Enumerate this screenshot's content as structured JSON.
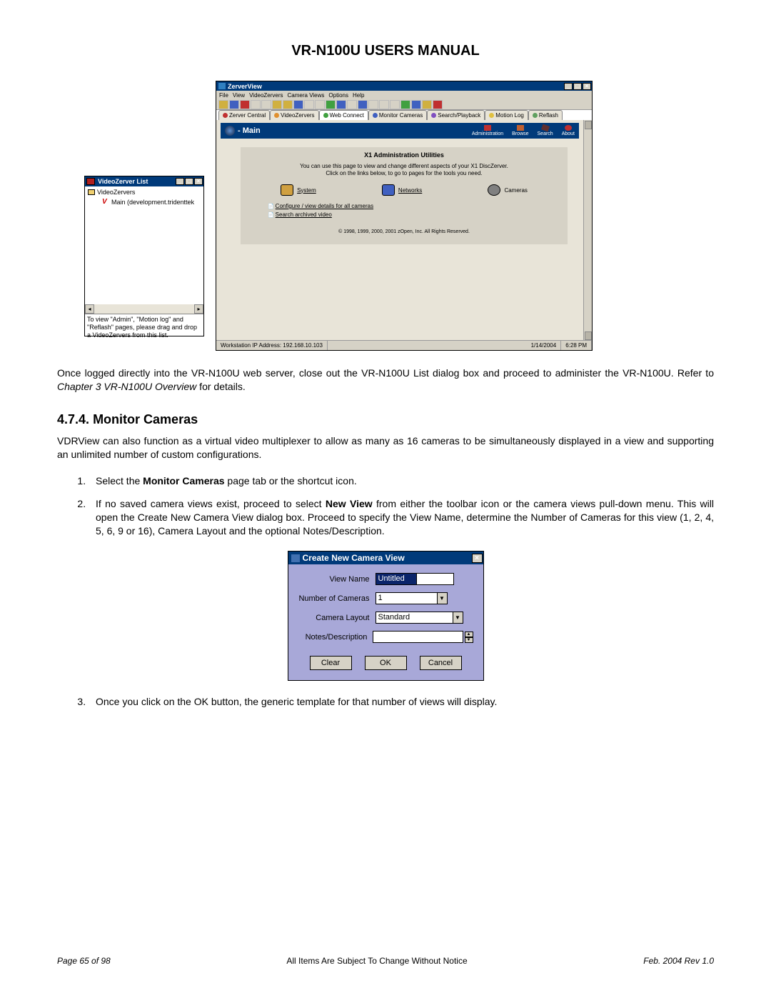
{
  "doc": {
    "title": "VR-N100U USERS MANUAL",
    "para1": "Once logged directly into the VR-N100U web server, close out the VR-N100U List dialog box and proceed to administer the VR-N100U. Refer to ",
    "para1_italic": "Chapter 3 VR-N100U Overview",
    "para1_tail": " for details.",
    "section_num": "4.7.4.",
    "section_title": "Monitor Cameras",
    "para2": "VDRView can also function as a virtual video multiplexer to allow as many as 16 cameras to be simultaneously displayed in a view and supporting an unlimited number of custom configurations.",
    "step1_pre": "Select the ",
    "step1_b": "Monitor Cameras",
    "step1_post": " page tab or the shortcut icon.",
    "step2_pre": "If no saved camera views exist, proceed to select ",
    "step2_b": "New View",
    "step2_post": " from either the toolbar icon or the camera views pull-down menu. This will open the Create New Camera View dialog box. Proceed to specify the View Name, determine the Number of Cameras for this view (1, 2, 4, 5, 6, 9 or 16), Camera Layout and the optional Notes/Description.",
    "step3": "Once you click on the OK button, the generic template for that number of views will display."
  },
  "vzlist": {
    "title": "VideoZerver List",
    "root": "VideoZervers",
    "child": "Main (development.tridenttek",
    "hint": "To view \"Admin\", \"Motion log\" and \"Reflash\" pages, please drag and drop a VideoZervers from this list."
  },
  "zv": {
    "title": "ZerverView",
    "menu": [
      "File",
      "View",
      "VideoZervers",
      "Camera Views",
      "Options",
      "Help"
    ],
    "tabs": [
      "Zerver Central",
      "VideoZervers",
      "Web Connect",
      "Monitor Cameras",
      "Search/Playback",
      "Motion Log",
      "Reflash"
    ],
    "banner_main": "- Main",
    "ricons": [
      "Administration",
      "Browse",
      "Search",
      "About"
    ],
    "panel_title": "X1 Administration Utilities",
    "panel_desc1": "You can use this page to view and change different aspects of your X1 DiscZerver.",
    "panel_desc2": "Click on the links below, to go to pages for the tools you need.",
    "links": [
      "System",
      "Networks",
      "Cameras"
    ],
    "sublinks": [
      "Configure / view details for all cameras",
      "Search archived video"
    ],
    "copyright": "© 1998, 1999, 2000, 2001 zOpen, Inc. All Rights Reserved.",
    "status_ip": "Workstation IP Address: 192.168.10.103",
    "status_date": "1/14/2004",
    "status_time": "6:28 PM"
  },
  "cncv": {
    "title": "Create New Camera View",
    "labels": {
      "view_name": "View Name",
      "num_cameras": "Number of Cameras",
      "camera_layout": "Camera Layout",
      "notes": "Notes/Description"
    },
    "values": {
      "view_name": "Untitled",
      "num_cameras": "1",
      "camera_layout": "Standard",
      "notes": ""
    },
    "buttons": {
      "clear": "Clear",
      "ok": "OK",
      "cancel": "Cancel"
    }
  },
  "footer": {
    "left": "Page 65 of 98",
    "center": "All Items Are Subject To Change Without Notice",
    "right": "Feb. 2004 Rev 1.0"
  }
}
